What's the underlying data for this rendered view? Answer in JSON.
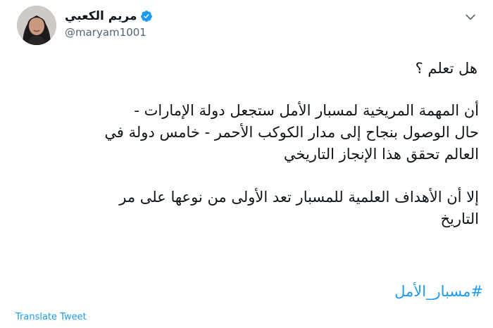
{
  "author": {
    "display_name": "مريم الكعبي",
    "handle": "@maryam1001",
    "verified": true
  },
  "tweet": {
    "question": "هل تعلم ؟",
    "paragraph1_line1": "أن المهمة المريخية لمسبار الأمل ستجعل دولة الإمارات -",
    "paragraph1_line2": "حال الوصول بنجاح إلى مدار الكوكب الأحمر - خامس دولة في",
    "paragraph1_line3": "العالم تحقق هذا الإنجاز التاريخي",
    "paragraph2_line1": "إلا أن الأهداف العلمية للمسبار تعد الأولى من نوعها على مر",
    "paragraph2_line2": "التاريخ",
    "hashtag": "#مسبار_الأمل",
    "translate_label": "Translate Tweet"
  },
  "icons": {
    "verified": "verified-badge-icon",
    "more": "chevron-down-icon"
  },
  "colors": {
    "accent": "#1d9bf0",
    "secondary_text": "#536471",
    "text": "#0f1419"
  }
}
